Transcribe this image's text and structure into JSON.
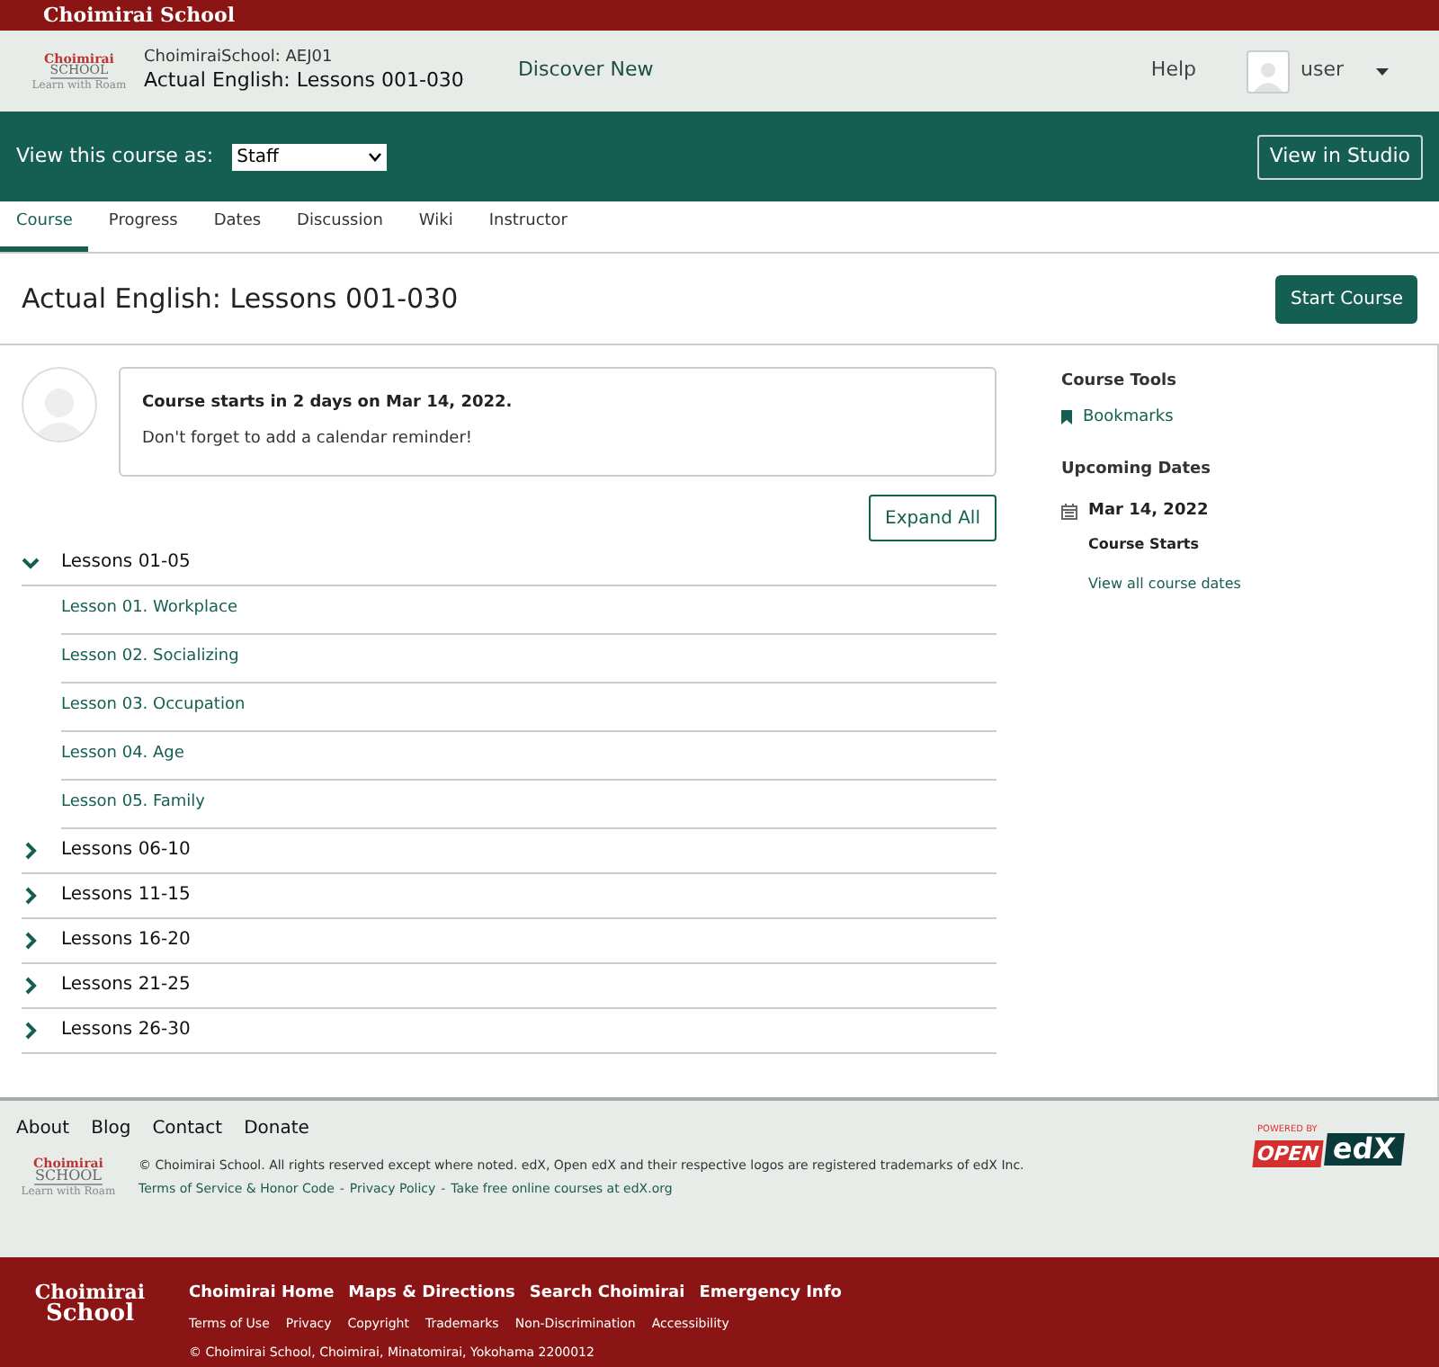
{
  "top_banner": {
    "title": "Choimirai School"
  },
  "header": {
    "logo": {
      "name": "Choimirai",
      "word": "SCHOOL",
      "tagline": "Learn with Roam"
    },
    "course_org": "ChoimiraiSchool: AEJ01",
    "course_title": "Actual English: Lessons 001-030",
    "discover": "Discover New",
    "help": "Help",
    "user": "user"
  },
  "staff_bar": {
    "label": "View this course as:",
    "select_value": "Staff",
    "studio_button": "View in Studio"
  },
  "tabs": [
    {
      "label": "Course",
      "selected": true
    },
    {
      "label": "Progress",
      "selected": false
    },
    {
      "label": "Dates",
      "selected": false
    },
    {
      "label": "Discussion",
      "selected": false
    },
    {
      "label": "Wiki",
      "selected": false
    },
    {
      "label": "Instructor",
      "selected": false
    }
  ],
  "page_title": "Actual English: Lessons 001-030",
  "start_button": "Start Course",
  "message": {
    "title": "Course starts in 2 days on Mar 14, 2022.",
    "body": "Don't forget to add a calendar reminder!"
  },
  "expand_button": "Expand All",
  "sections": [
    {
      "title": "Lessons 01-05",
      "expanded": true,
      "children": [
        {
          "title": "Lesson 01. Workplace"
        },
        {
          "title": "Lesson 02. Socializing"
        },
        {
          "title": "Lesson 03. Occupation"
        },
        {
          "title": "Lesson 04. Age"
        },
        {
          "title": "Lesson 05. Family"
        }
      ]
    },
    {
      "title": "Lessons 06-10",
      "expanded": false
    },
    {
      "title": "Lessons 11-15",
      "expanded": false
    },
    {
      "title": "Lessons 16-20",
      "expanded": false
    },
    {
      "title": "Lessons 21-25",
      "expanded": false
    },
    {
      "title": "Lessons 26-30",
      "expanded": false
    }
  ],
  "sidebar": {
    "tools_heading": "Course Tools",
    "bookmarks": "Bookmarks",
    "dates_heading": "Upcoming Dates",
    "date": "Mar 14, 2022",
    "date_event": "Course Starts",
    "all_dates_link": "View all course dates"
  },
  "footer": {
    "links": [
      "About",
      "Blog",
      "Contact",
      "Donate"
    ],
    "copyright": "© Choimirai School. All rights reserved except where noted. edX, Open edX and their respective logos are registered trademarks of edX Inc.",
    "logo": {
      "name": "Choimirai",
      "word": "SCHOOL",
      "tagline": "Learn with Roam"
    },
    "legal_links": [
      {
        "kind": "link",
        "text": "Terms of Service & Honor Code"
      },
      {
        "kind": "separator",
        "text": "-"
      },
      {
        "kind": "link",
        "text": "Privacy Policy"
      },
      {
        "kind": "separator",
        "text": "-"
      },
      {
        "kind": "link",
        "text": "Take free online courses at edX.org"
      }
    ],
    "powered_by": {
      "small": "POWERED BY",
      "open": "OPEN",
      "edx": "edX"
    }
  },
  "bottom_footer": {
    "logo_lines": [
      "Choimirai",
      "School"
    ],
    "main_links": [
      "Choimirai Home",
      "Maps & Directions",
      "Search Choimirai",
      "Emergency Info"
    ],
    "small_links": [
      "Terms of Use",
      "Privacy",
      "Copyright",
      "Trademarks",
      "Non-Discrimination",
      "Accessibility"
    ],
    "address": "© Choimirai School, Choimirai, Minatomirai, Yokohama 2200012"
  }
}
